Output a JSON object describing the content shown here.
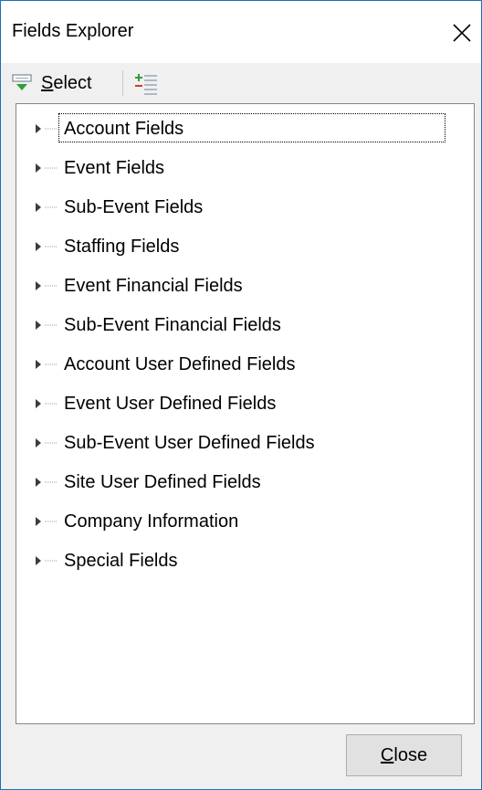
{
  "window": {
    "title": "Fields Explorer"
  },
  "toolbar": {
    "select_mnemonic": "S",
    "select_rest": "elect",
    "select_icon": "select-filter-icon",
    "expand_icon": "expand-all-icon"
  },
  "tree": {
    "items": [
      {
        "label": "Account Fields"
      },
      {
        "label": "Event Fields"
      },
      {
        "label": "Sub-Event Fields"
      },
      {
        "label": "Staffing Fields"
      },
      {
        "label": "Event Financial Fields"
      },
      {
        "label": "Sub-Event Financial Fields"
      },
      {
        "label": "Account User Defined Fields"
      },
      {
        "label": "Event User Defined Fields"
      },
      {
        "label": "Sub-Event User Defined Fields"
      },
      {
        "label": "Site User Defined Fields"
      },
      {
        "label": "Company Information"
      },
      {
        "label": "Special Fields"
      }
    ]
  },
  "footer": {
    "close_mnemonic": "C",
    "close_rest": "lose"
  },
  "colors": {
    "window_border": "#1f6fb5",
    "accent_green": "#2e9e3e",
    "accent_red": "#d9382b"
  }
}
